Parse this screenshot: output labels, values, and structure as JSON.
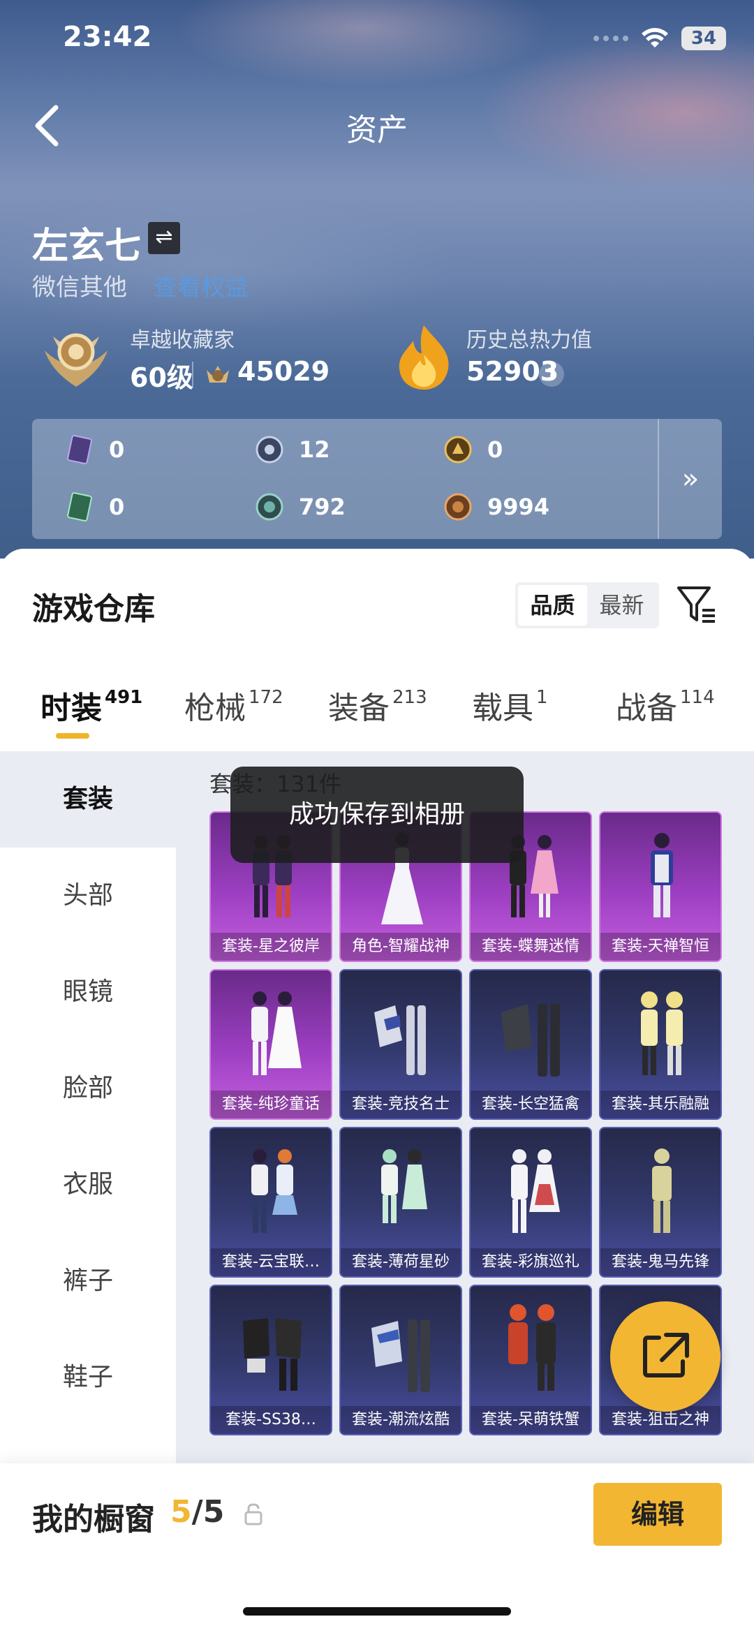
{
  "status": {
    "time": "23:42",
    "battery": "34"
  },
  "nav": {
    "title": "资产"
  },
  "profile": {
    "name": "左玄七",
    "platform": "微信其他",
    "platform_link": "查看权益"
  },
  "rank": {
    "title": "卓越收藏家",
    "level": "60级",
    "coins": "45029"
  },
  "heat": {
    "title": "历史总热力值",
    "value": "52903",
    "help": "?"
  },
  "currencies": [
    {
      "icon": "purple-card-icon",
      "value": "0"
    },
    {
      "icon": "silver-coin-icon",
      "value": "12"
    },
    {
      "icon": "gold-medal-icon",
      "value": "0"
    },
    {
      "icon": "green-card-icon",
      "value": "0"
    },
    {
      "icon": "teal-coin-icon",
      "value": "792"
    },
    {
      "icon": "bronze-coin-icon",
      "value": "9994"
    }
  ],
  "currency_more": "»",
  "warehouse": {
    "title": "游戏仓库",
    "sort_options": [
      "品质",
      "最新"
    ],
    "sort_active": "品质"
  },
  "tabs": [
    {
      "label": "时装",
      "count": "491",
      "active": true
    },
    {
      "label": "枪械",
      "count": "172",
      "active": false
    },
    {
      "label": "装备",
      "count": "213",
      "active": false
    },
    {
      "label": "载具",
      "count": "1",
      "active": false
    },
    {
      "label": "战备",
      "count": "114",
      "active": false
    }
  ],
  "categories": [
    {
      "label": "套装",
      "active": true
    },
    {
      "label": "头部",
      "active": false
    },
    {
      "label": "眼镜",
      "active": false
    },
    {
      "label": "脸部",
      "active": false
    },
    {
      "label": "衣服",
      "active": false
    },
    {
      "label": "裤子",
      "active": false
    },
    {
      "label": "鞋子",
      "active": false
    }
  ],
  "suit_count": "套装：131件",
  "items": [
    {
      "label": "套装-星之彼岸",
      "rarity": "purple"
    },
    {
      "label": "角色-智耀战神",
      "rarity": "purple"
    },
    {
      "label": "套装-蝶舞迷情",
      "rarity": "purple"
    },
    {
      "label": "套装-天禅智恒",
      "rarity": "purple"
    },
    {
      "label": "套装-纯珍童话",
      "rarity": "purple"
    },
    {
      "label": "套装-竞技名士",
      "rarity": "blue"
    },
    {
      "label": "套装-长空猛禽",
      "rarity": "blue"
    },
    {
      "label": "套装-其乐融融",
      "rarity": "blue"
    },
    {
      "label": "套装-云宝联…",
      "rarity": "blue"
    },
    {
      "label": "套装-薄荷星砂",
      "rarity": "blue"
    },
    {
      "label": "套装-彩旗巡礼",
      "rarity": "blue"
    },
    {
      "label": "套装-鬼马先锋",
      "rarity": "blue"
    },
    {
      "label": "套装-SS38…",
      "rarity": "blue"
    },
    {
      "label": "套装-潮流炫酷",
      "rarity": "blue"
    },
    {
      "label": "套装-呆萌铁蟹",
      "rarity": "blue"
    },
    {
      "label": "套装-狙击之神",
      "rarity": "blue"
    }
  ],
  "toast": "成功保存到相册",
  "showcase": {
    "label": "我的橱窗",
    "current": "5",
    "total": "/5"
  },
  "edit_button": "编辑",
  "colors": {
    "accent": "#f2b632",
    "purple_card": "#9d3fc2",
    "blue_card": "#333a6e"
  }
}
